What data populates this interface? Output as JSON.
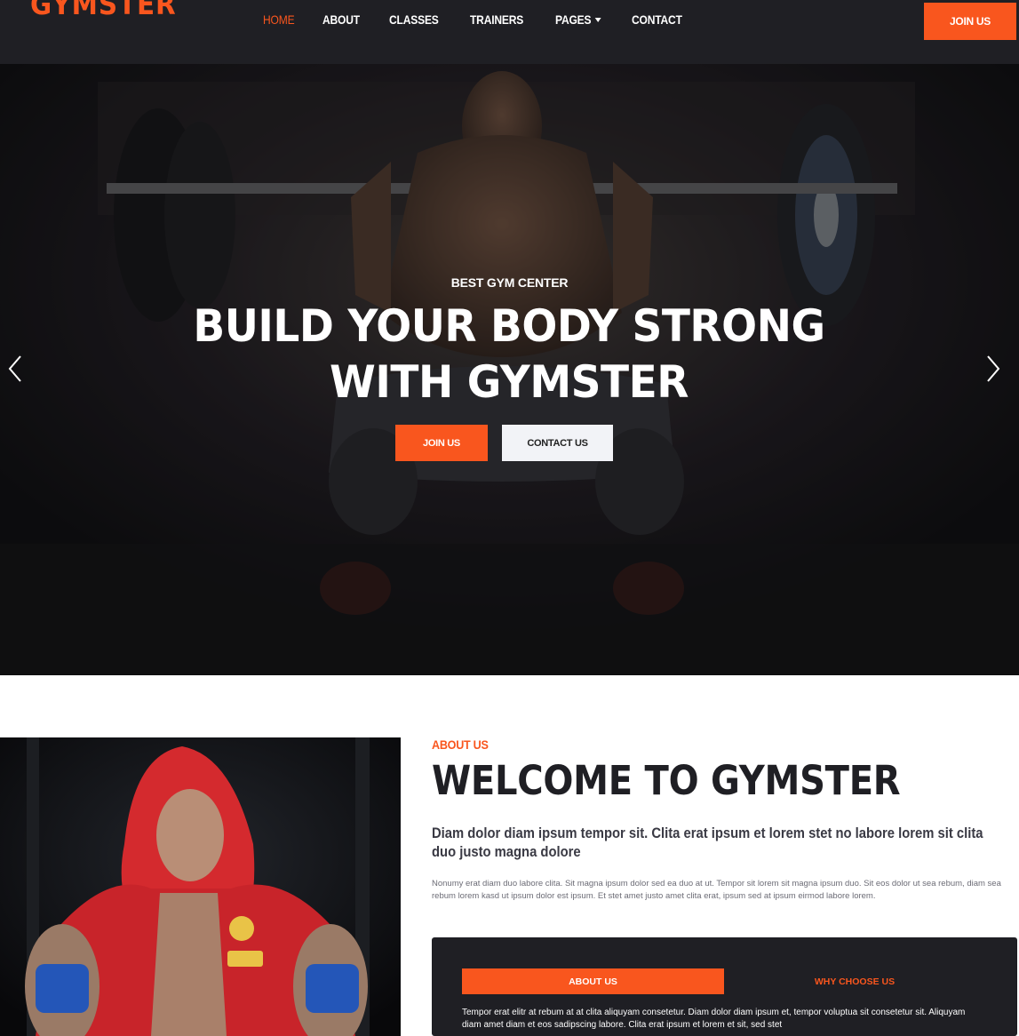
{
  "brand": {
    "name": "GYMSTER"
  },
  "nav": {
    "items": [
      {
        "label": "HOME"
      },
      {
        "label": "ABOUT"
      },
      {
        "label": "CLASSES"
      },
      {
        "label": "TRAINERS"
      },
      {
        "label": "PAGES"
      },
      {
        "label": "CONTACT"
      }
    ],
    "join_label": "JOIN US"
  },
  "hero": {
    "eyebrow": "BEST GYM CENTER",
    "title": "BUILD YOUR BODY STRONG WITH GYMSTER",
    "primary_button": "JOIN US",
    "secondary_button": "CONTACT US"
  },
  "about": {
    "eyebrow": "ABOUT US",
    "title": "WELCOME TO GYMSTER",
    "lead": "Diam dolor diam ipsum tempor sit. Clita erat ipsum et lorem stet no labore lorem sit clita duo justo magna dolore",
    "text": "Nonumy erat diam duo labore clita. Sit magna ipsum dolor sed ea duo at ut. Tempor sit lorem sit magna ipsum duo. Sit eos dolor ut sea rebum, diam sea rebum lorem kasd ut ipsum dolor est ipsum. Et stet amet justo amet clita erat, ipsum sed at ipsum eirmod labore lorem.",
    "tabs": [
      {
        "label": "ABOUT US"
      },
      {
        "label": "WHY CHOOSE US"
      }
    ],
    "tab_text": "Tempor erat elitr at rebum at at clita aliquyam consetetur. Diam dolor diam ipsum et, tempor voluptua sit consetetur sit. Aliquyam diam amet diam et eos sadipscing labore. Clita erat ipsum et lorem et sit, sed stet"
  },
  "colors": {
    "accent": "#f9561e",
    "dark": "#1f1f24"
  }
}
